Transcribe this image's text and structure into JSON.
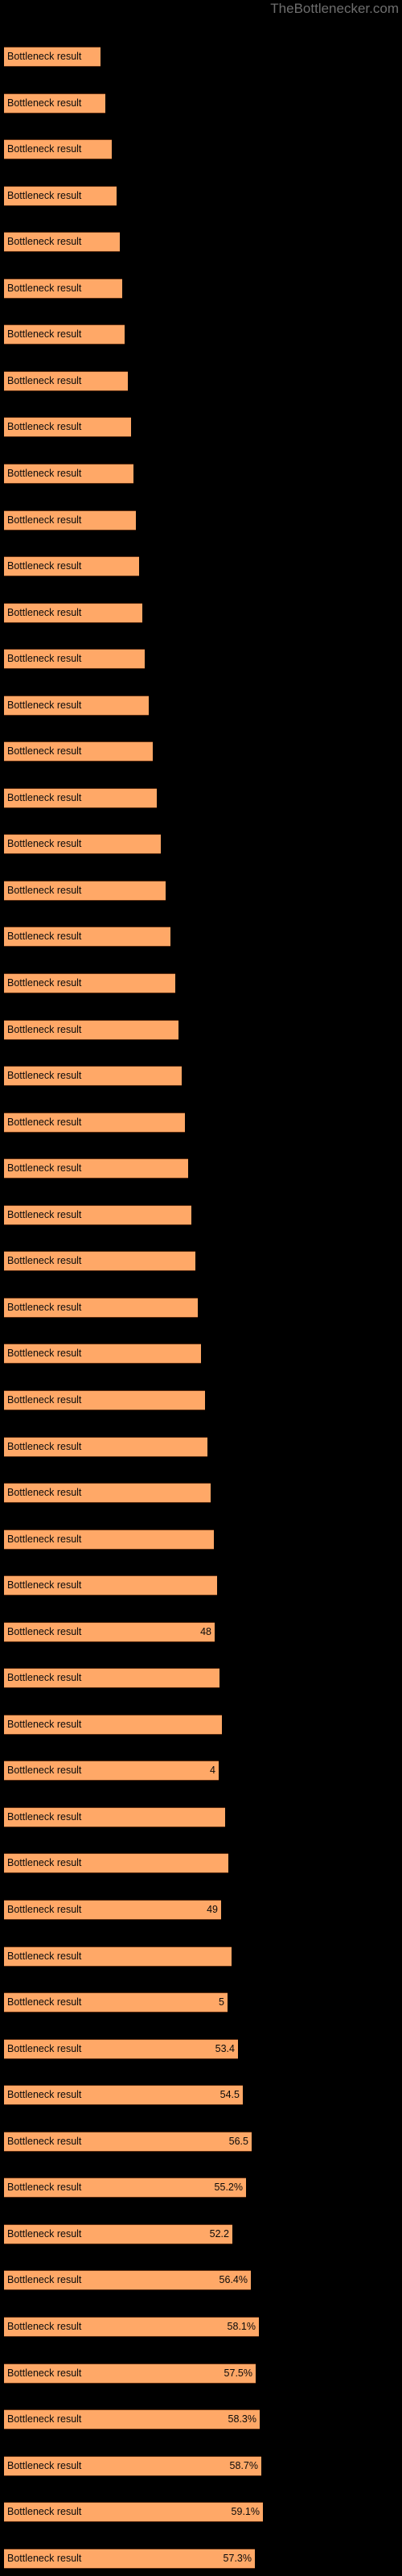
{
  "watermark": "TheBottlenecker.com",
  "colors": {
    "background": "#000000",
    "bar_fill": "#ffa867",
    "bar_border": "#5a2d11",
    "label_text": "#0a0a0a",
    "watermark_text": "#6e6e6e"
  },
  "bar_label_text": "Bottleneck result",
  "chart_data": {
    "type": "bar",
    "orientation": "horizontal",
    "title": "",
    "subtitle": "",
    "xlabel": "",
    "ylabel": "",
    "grid": false,
    "legend": null,
    "xlim": [
      0,
      62
    ],
    "categories": [
      "Bottleneck result",
      "Bottleneck result",
      "Bottleneck result",
      "Bottleneck result",
      "Bottleneck result",
      "Bottleneck result",
      "Bottleneck result",
      "Bottleneck result",
      "Bottleneck result",
      "Bottleneck result",
      "Bottleneck result",
      "Bottleneck result",
      "Bottleneck result",
      "Bottleneck result",
      "Bottleneck result",
      "Bottleneck result",
      "Bottleneck result",
      "Bottleneck result",
      "Bottleneck result",
      "Bottleneck result",
      "Bottleneck result",
      "Bottleneck result",
      "Bottleneck result",
      "Bottleneck result",
      "Bottleneck result",
      "Bottleneck result",
      "Bottleneck result",
      "Bottleneck result",
      "Bottleneck result",
      "Bottleneck result",
      "Bottleneck result",
      "Bottleneck result",
      "Bottleneck result",
      "Bottleneck result",
      "Bottleneck result",
      "Bottleneck result",
      "Bottleneck result",
      "Bottleneck result",
      "Bottleneck result",
      "Bottleneck result",
      "Bottleneck result",
      "Bottleneck result",
      "Bottleneck result",
      "Bottleneck result",
      "Bottleneck result",
      "Bottleneck result",
      "Bottleneck result",
      "Bottleneck result",
      "Bottleneck result",
      "Bottleneck result",
      "Bottleneck result",
      "Bottleneck result",
      "Bottleneck result",
      "Bottleneck result"
    ],
    "values": [
      22.0,
      23.2,
      24.5,
      25.6,
      26.4,
      27.0,
      27.6,
      28.2,
      28.9,
      29.5,
      30.1,
      30.8,
      31.5,
      32.2,
      33.0,
      33.9,
      34.8,
      35.8,
      36.9,
      38.0,
      39.0,
      39.8,
      40.5,
      41.3,
      42.0,
      42.8,
      43.6,
      44.3,
      45.0,
      45.8,
      46.5,
      47.2,
      47.9,
      48.6,
      48.0,
      49.2,
      49.8,
      49.0,
      50.5,
      51.2,
      49.5,
      52.0,
      51.0,
      53.4,
      54.5,
      56.5,
      55.2,
      52.2,
      56.4,
      58.1,
      57.5,
      58.3,
      58.7,
      59.1
    ],
    "displayed_value_labels": [
      "",
      "",
      "",
      "",
      "",
      "",
      "",
      "",
      "",
      "",
      "",
      "",
      "",
      "",
      "",
      "",
      "",
      "",
      "",
      "",
      "",
      "",
      "",
      "",
      "",
      "",
      "",
      "",
      "",
      "",
      "",
      "",
      "",
      "",
      "48",
      "",
      "",
      "4",
      "",
      "",
      "49",
      "",
      "5",
      "53.4",
      "54.5",
      "56.5",
      "55.2%",
      "52.2",
      "56.4%",
      "58.1%",
      "57.5%",
      "58.3%",
      "58.7%",
      "59.1%"
    ]
  },
  "extra_bar": {
    "label": "Bottleneck result",
    "value_label": "57.3%",
    "value": 57.3
  }
}
